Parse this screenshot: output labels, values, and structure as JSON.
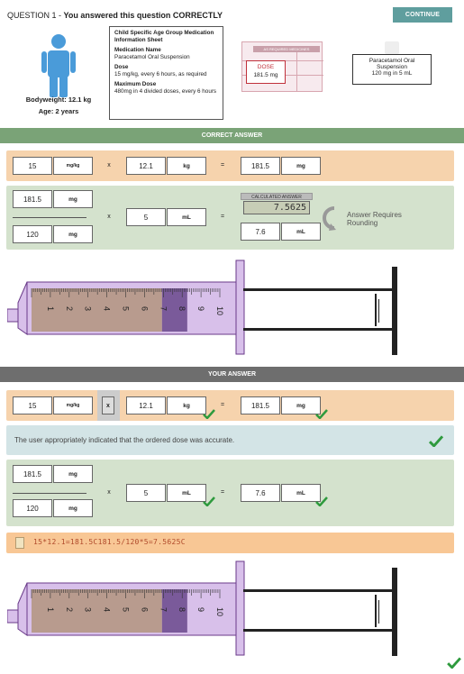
{
  "question": {
    "prefix": "QUESTION 1 - ",
    "result": "You answered this question CORRECTLY",
    "continue_label": "CONTINUE"
  },
  "patient": {
    "bodyweight": "Bodyweight: 12.1 kg",
    "age": "Age: 2 years"
  },
  "info_sheet": {
    "title": "Child Specific Age Group Medication Information Sheet",
    "med_name_label": "Medication Name",
    "med_name": "Paracetamol Oral Suspension",
    "dose_label": "Dose",
    "dose": "15 mg/kg, every 6 hours, as required",
    "max_label": "Maximum Dose",
    "max": "480mg in 4 divided doses, every 6 hours"
  },
  "label_card": {
    "header": "AS REQUIRED MEDICINES",
    "dose_label": "DOSE",
    "dose_value": "181.5 mg"
  },
  "bottle": {
    "line1": "Paracetamol Oral",
    "line2": "Suspension",
    "line3": "120 mg in 5 mL"
  },
  "correct_section": {
    "title": "CORRECT ANSWER",
    "row1": {
      "a": "15",
      "a_unit": "mg/kg",
      "op1": "x",
      "b": "12.1",
      "b_unit": "kg",
      "eq": "=",
      "c": "181.5",
      "c_unit": "mg"
    },
    "row2": {
      "num": "181.5",
      "num_unit": "mg",
      "den": "120",
      "den_unit": "mg",
      "op1": "x",
      "b": "5",
      "b_unit": "mL",
      "eq": "=",
      "c": "7.6",
      "c_unit": "mL"
    },
    "calculator": {
      "title": "CALCULATED ANSWER",
      "value": "7.5625"
    },
    "rounding_note": "Answer Requires Rounding"
  },
  "your_section": {
    "title": "YOUR ANSWER",
    "row1": {
      "a": "15",
      "a_unit": "mg/kg",
      "op1": "x",
      "b": "12.1",
      "b_unit": "kg",
      "eq": "=",
      "c": "181.5",
      "c_unit": "mg"
    },
    "message": "The user appropriately indicated that the ordered dose was accurate.",
    "row2": {
      "num": "181.5",
      "num_unit": "mg",
      "den": "120",
      "den_unit": "mg",
      "op1": "x",
      "b": "5",
      "b_unit": "mL",
      "eq": "=",
      "c": "7.6",
      "c_unit": "mL"
    },
    "working": "15*12.1=181.5C181.5/120*5=7.5625C"
  },
  "syringe": {
    "scale_labels": [
      "1",
      "2",
      "3",
      "4",
      "5",
      "6",
      "7",
      "8",
      "9",
      "10"
    ],
    "fill_ml": 7.6,
    "max_ml": 10
  },
  "colors": {
    "check": "#2e9a3d",
    "syringe_fill": "#7a5a9a",
    "barrel": "#d8c0ea",
    "liquid": "#b89b8e"
  }
}
